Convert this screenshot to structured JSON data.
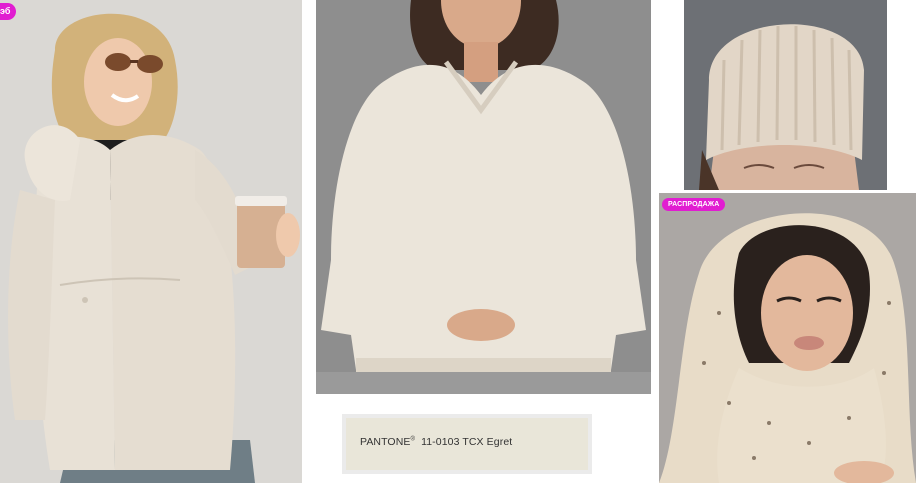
{
  "colors": {
    "sale_badge_bg": "#e11dd1",
    "product_tone": "#ebe4d8",
    "pantone_swatch": "#e9e6d9"
  },
  "tiles": [
    {
      "id": "coat",
      "badge": "эб",
      "depicts": "beige-hooded-parka"
    },
    {
      "id": "sweater",
      "badge": "",
      "depicts": "cream-v-neck-sweater"
    },
    {
      "id": "hat",
      "badge": "",
      "depicts": "beige-ribbed-beanie"
    },
    {
      "id": "scarf",
      "badge": "РАСПРОДАЖА",
      "depicts": "cream-knit-hood-scarf"
    }
  ],
  "pantone": {
    "brand": "PANTONE",
    "reg": "®",
    "code": "11-0103 TCX Egret"
  }
}
